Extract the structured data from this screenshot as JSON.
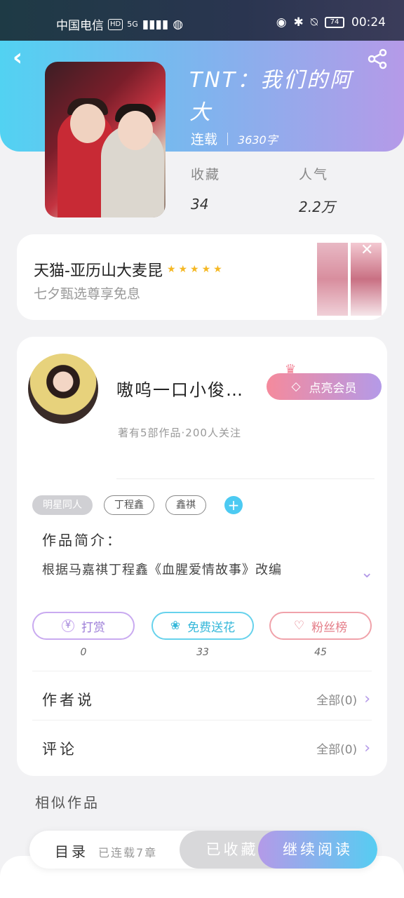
{
  "status_bar": {
    "carrier": "中国电信",
    "hd_badge": "HD",
    "network": "5G",
    "battery": "74",
    "time": "00:24"
  },
  "book": {
    "title": "TNT：我们的阿大",
    "status": "连载",
    "word_count": "3630字",
    "favorites_label": "收藏",
    "favorites_value": "34",
    "popularity_label": "人气",
    "popularity_value": "2.2万"
  },
  "ad": {
    "title": "天猫-亚历山大麦昆",
    "stars": "★★★★★",
    "subtitle": "七夕甄选尊享免息"
  },
  "author": {
    "name": "嗷呜一口小俊…",
    "meta": "著有5部作品·200人关注",
    "vip_button": "点亮会员"
  },
  "tags": [
    "明星同人",
    "丁程鑫",
    "鑫祺"
  ],
  "intro": {
    "label": "作品简介：",
    "text": "根据马嘉祺丁程鑫《血腥爱情故事》改编"
  },
  "actions": [
    {
      "label": "打赏",
      "count": "0"
    },
    {
      "label": "免费送花",
      "count": "33"
    },
    {
      "label": "粉丝榜",
      "count": "45"
    }
  ],
  "rows": {
    "author_says": {
      "label": "作者说",
      "value": "全部(0)"
    },
    "comments": {
      "label": "评论",
      "value": "全部(0)"
    }
  },
  "similar_label": "相似作品",
  "bottom": {
    "toc": "目录",
    "toc_sub": "已连载7章",
    "favorited": "已收藏",
    "continue": "继续阅读"
  },
  "colors": {
    "accent_cyan": "#52d2f2",
    "accent_purple": "#b49ae8",
    "accent_pink": "#f58a9c"
  }
}
